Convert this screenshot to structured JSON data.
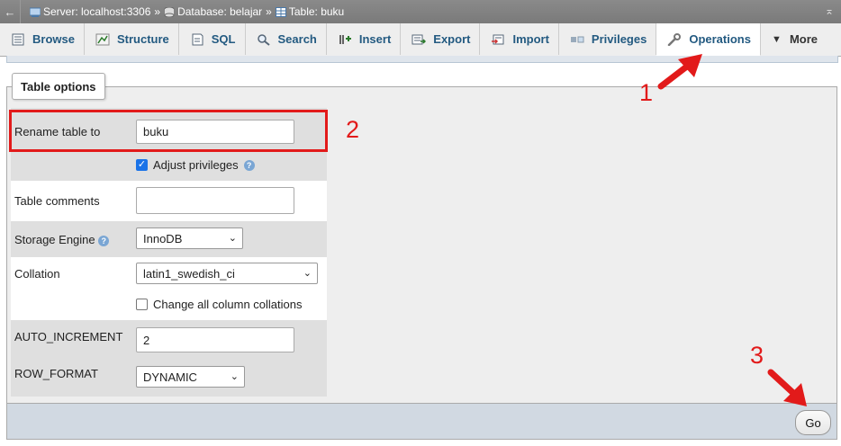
{
  "breadcrumb": {
    "server": "Server: localhost:3306",
    "database": "Database: belajar",
    "table": "Table: buku",
    "separator": "»"
  },
  "tabs": [
    {
      "label": "Browse",
      "icon": "browse-icon"
    },
    {
      "label": "Structure",
      "icon": "structure-icon"
    },
    {
      "label": "SQL",
      "icon": "sql-icon"
    },
    {
      "label": "Search",
      "icon": "search-icon"
    },
    {
      "label": "Insert",
      "icon": "insert-icon"
    },
    {
      "label": "Export",
      "icon": "export-icon"
    },
    {
      "label": "Import",
      "icon": "import-icon"
    },
    {
      "label": "Privileges",
      "icon": "privileges-icon"
    },
    {
      "label": "Operations",
      "icon": "wrench-icon",
      "active": true
    },
    {
      "label": "More",
      "icon": "caret-down-icon"
    }
  ],
  "fieldset": {
    "legend": "Table options",
    "rename_label": "Rename table to",
    "rename_value": "buku",
    "adjust_privileges_label": "Adjust privileges",
    "adjust_privileges_checked": true,
    "comments_label": "Table comments",
    "comments_value": "",
    "engine_label": "Storage Engine",
    "engine_value": "InnoDB",
    "collation_label": "Collation",
    "collation_value": "latin1_swedish_ci",
    "change_collations_label": "Change all column collations",
    "change_collations_checked": false,
    "auto_increment_label": "AUTO_INCREMENT",
    "auto_increment_value": "2",
    "row_format_label": "ROW_FORMAT",
    "row_format_value": "DYNAMIC"
  },
  "go_label": "Go",
  "annotations": {
    "step1": "1",
    "step2": "2",
    "step3": "3",
    "color": "#e21a1a"
  }
}
